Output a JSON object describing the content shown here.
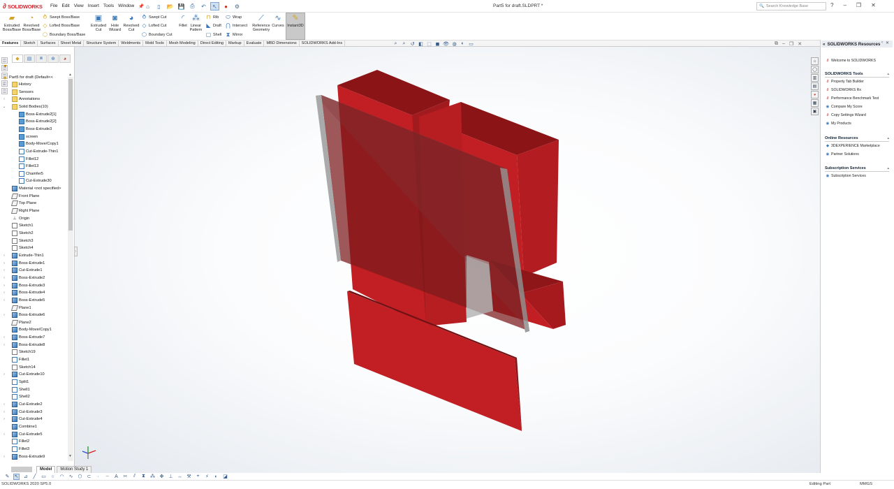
{
  "app": {
    "name": "SOLIDWORKS",
    "doc_title": "Part5 for draft.SLDPRT *"
  },
  "menu": [
    "File",
    "Edit",
    "View",
    "Insert",
    "Tools",
    "Window"
  ],
  "search": {
    "placeholder": "Search Knowledge Base"
  },
  "toolbar": {
    "extruded_boss": "Extruded Boss/Base",
    "revolved_boss": "Revolved Boss/Base",
    "swept_boss": "Swept Boss/Base",
    "lofted_boss": "Lofted Boss/Base",
    "boundary_boss": "Boundary Boss/Base",
    "extruded_cut": "Extruded Cut",
    "hole_wizard": "Hole Wizard",
    "revolved_cut": "Revolved Cut",
    "swept_cut": "Swept Cut",
    "lofted_cut": "Lofted Cut",
    "boundary_cut": "Boundary Cut",
    "fillet": "Fillet",
    "linear_pattern": "Linear Pattern",
    "rib": "Rib",
    "draft": "Draft",
    "shell": "Shell",
    "wrap": "Wrap",
    "intersect": "Intersect",
    "mirror": "Mirror",
    "reference_geometry": "Reference Geometry",
    "curves": "Curves",
    "instant3d": "Instant3D"
  },
  "tabs": [
    "Features",
    "Sketch",
    "Surfaces",
    "Sheet Metal",
    "Structure System",
    "Weldments",
    "Mold Tools",
    "Mesh Modeling",
    "Direct Editing",
    "Markup",
    "Evaluate",
    "MBD Dimensions",
    "SOLIDWORKS Add-Ins"
  ],
  "tree": {
    "root": "Part5 for draft  (Default<<",
    "items": [
      {
        "label": "History",
        "icon": "folder",
        "level": 1,
        "expand": "collapsed"
      },
      {
        "label": "Sensors",
        "icon": "folder",
        "level": 1,
        "expand": "none"
      },
      {
        "label": "Annotations",
        "icon": "folder",
        "level": 1,
        "expand": "collapsed"
      },
      {
        "label": "Solid Bodies(10)",
        "icon": "folder",
        "level": 1,
        "expand": "expanded"
      },
      {
        "label": "Boss-Extrude2[1]",
        "icon": "body",
        "level": 2,
        "expand": "none"
      },
      {
        "label": "Boss-Extrude2[2]",
        "icon": "body",
        "level": 2,
        "expand": "none"
      },
      {
        "label": "Boss-Extrude3",
        "icon": "body",
        "level": 2,
        "expand": "none"
      },
      {
        "label": "screen",
        "icon": "body",
        "level": 2,
        "expand": "none"
      },
      {
        "label": "Body-Move/Copy1",
        "icon": "body",
        "level": 2,
        "expand": "none"
      },
      {
        "label": "Cut-Extrude-Thin1",
        "icon": "outline",
        "level": 2,
        "expand": "none"
      },
      {
        "label": "Fillet12",
        "icon": "outline",
        "level": 2,
        "expand": "none"
      },
      {
        "label": "Fillet13",
        "icon": "outline",
        "level": 2,
        "expand": "none"
      },
      {
        "label": "Chamfer5",
        "icon": "outline",
        "level": 2,
        "expand": "none"
      },
      {
        "label": "Cut-Extrude30",
        "icon": "outline",
        "level": 2,
        "expand": "none"
      },
      {
        "label": "Material <not specified>",
        "icon": "feat",
        "level": 1,
        "expand": "none"
      },
      {
        "label": "Front Plane",
        "icon": "plane",
        "level": 1,
        "expand": "none"
      },
      {
        "label": "Top Plane",
        "icon": "plane",
        "level": 1,
        "expand": "none"
      },
      {
        "label": "Right Plane",
        "icon": "plane",
        "level": 1,
        "expand": "none"
      },
      {
        "label": "Origin",
        "icon": "origin",
        "level": 1,
        "expand": "none"
      },
      {
        "label": "Sketch1",
        "icon": "sketch",
        "level": 1,
        "expand": "none"
      },
      {
        "label": "Sketch2",
        "icon": "sketch",
        "level": 1,
        "expand": "none"
      },
      {
        "label": "Sketch3",
        "icon": "sketch",
        "level": 1,
        "expand": "none"
      },
      {
        "label": "Sketch4",
        "icon": "sketch",
        "level": 1,
        "expand": "none"
      },
      {
        "label": "Extrude-Thin1",
        "icon": "feat",
        "level": 1,
        "expand": "collapsed"
      },
      {
        "label": "Boss-Extrude1",
        "icon": "feat",
        "level": 1,
        "expand": "collapsed"
      },
      {
        "label": "Cut-Extrude1",
        "icon": "feat",
        "level": 1,
        "expand": "collapsed"
      },
      {
        "label": "Boss-Extrude2",
        "icon": "feat",
        "level": 1,
        "expand": "collapsed"
      },
      {
        "label": "Boss-Extrude3",
        "icon": "feat",
        "level": 1,
        "expand": "collapsed"
      },
      {
        "label": "Boss-Extrude4",
        "icon": "feat",
        "level": 1,
        "expand": "collapsed"
      },
      {
        "label": "Boss-Extrude5",
        "icon": "feat",
        "level": 1,
        "expand": "collapsed"
      },
      {
        "label": "Plane1",
        "icon": "plane",
        "level": 1,
        "expand": "none"
      },
      {
        "label": "Boss-Extrude6",
        "icon": "feat",
        "level": 1,
        "expand": "collapsed"
      },
      {
        "label": "Plane2",
        "icon": "plane",
        "level": 1,
        "expand": "none"
      },
      {
        "label": "Body-Move/Copy1",
        "icon": "feat",
        "level": 1,
        "expand": "none"
      },
      {
        "label": "Boss-Extrude7",
        "icon": "feat",
        "level": 1,
        "expand": "collapsed"
      },
      {
        "label": "Boss-Extrude8",
        "icon": "feat",
        "level": 1,
        "expand": "collapsed"
      },
      {
        "label": "Sketch19",
        "icon": "sketch",
        "level": 1,
        "expand": "none"
      },
      {
        "label": "Fillet1",
        "icon": "outline",
        "level": 1,
        "expand": "none"
      },
      {
        "label": "Sketch14",
        "icon": "sketch",
        "level": 1,
        "expand": "none"
      },
      {
        "label": "Cut-Extrude10",
        "icon": "feat",
        "level": 1,
        "expand": "collapsed"
      },
      {
        "label": "Split1",
        "icon": "outline",
        "level": 1,
        "expand": "none"
      },
      {
        "label": "Shell1",
        "icon": "outline",
        "level": 1,
        "expand": "none"
      },
      {
        "label": "Shell2",
        "icon": "outline",
        "level": 1,
        "expand": "none"
      },
      {
        "label": "Cut-Extrude2",
        "icon": "feat",
        "level": 1,
        "expand": "collapsed"
      },
      {
        "label": "Cut-Extrude3",
        "icon": "feat",
        "level": 1,
        "expand": "collapsed"
      },
      {
        "label": "Cut-Extrude4",
        "icon": "feat",
        "level": 1,
        "expand": "collapsed"
      },
      {
        "label": "Combine1",
        "icon": "feat",
        "level": 1,
        "expand": "none"
      },
      {
        "label": "Cut-Extrude5",
        "icon": "feat",
        "level": 1,
        "expand": "collapsed"
      },
      {
        "label": "Fillet2",
        "icon": "outline",
        "level": 1,
        "expand": "none"
      },
      {
        "label": "Fillet3",
        "icon": "outline",
        "level": 1,
        "expand": "none"
      },
      {
        "label": "Boss-Extrude9",
        "icon": "feat",
        "level": 1,
        "expand": "collapsed"
      }
    ]
  },
  "model_tabs": [
    "Model",
    "Motion Study 1"
  ],
  "resources": {
    "title": "SOLIDWORKS Resources",
    "welcome": "Welcome to SOLIDWORKS",
    "sections": [
      {
        "title": "SOLIDWORKS Tools",
        "items": [
          "Property Tab Builder",
          "SOLIDWORKS Rx",
          "Performance Benchmark Test",
          "Compare My Score",
          "Copy Settings Wizard",
          "My Products"
        ]
      },
      {
        "title": "Online Resources",
        "items": [
          "3DEXPERIENCE Marketplace",
          "Partner Solutions"
        ]
      },
      {
        "title": "Subscription Services",
        "items": [
          "Subscription Services"
        ]
      }
    ]
  },
  "status": {
    "left": "SOLIDWORKS 2020 SP5.0",
    "mode": "Editing Part",
    "units": "MMGS"
  },
  "colors": {
    "body_red": "#c21f24",
    "body_dark": "#7a1416",
    "screen_grey": "#a5a5a5",
    "brand_red": "#d2232a"
  }
}
